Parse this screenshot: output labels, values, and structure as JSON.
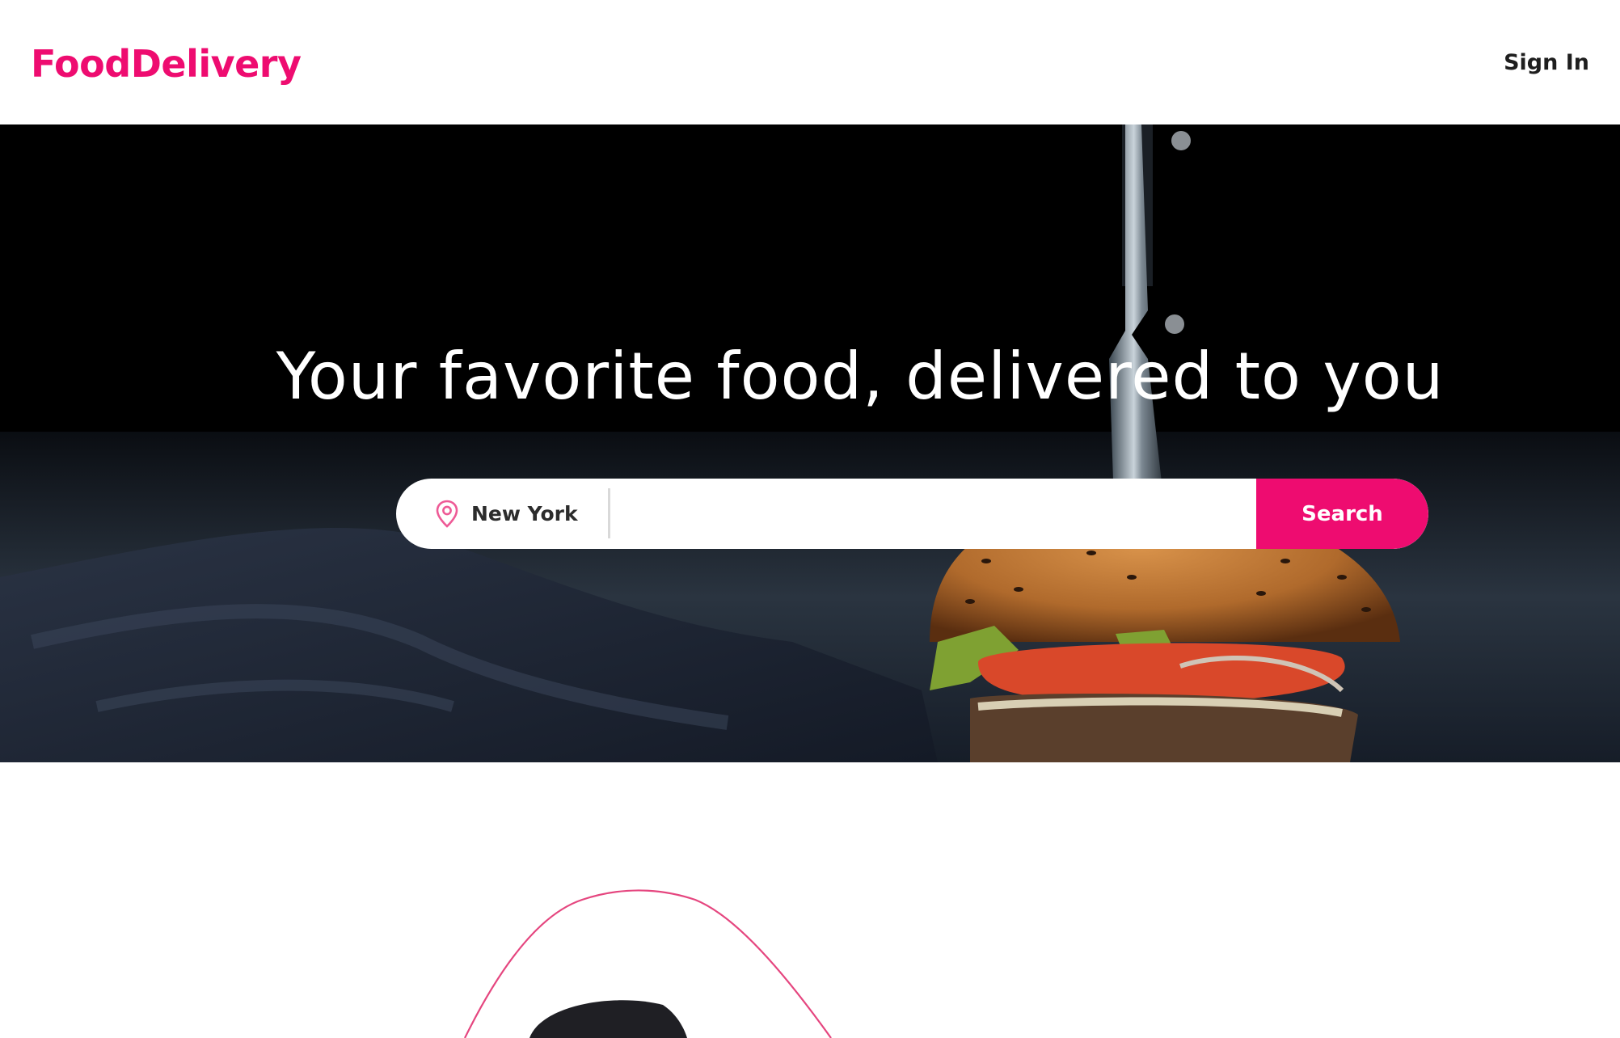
{
  "brand": {
    "name": "FoodDelivery",
    "color": "#ee0c70"
  },
  "header": {
    "sign_in_label": "Sign In"
  },
  "hero": {
    "title": "Your favorite food, delivered to you",
    "image": "burger-with-knife-photo"
  },
  "search": {
    "location_icon": "map-pin-icon",
    "location": "New York",
    "query_value": "",
    "button_label": "Search"
  },
  "colors": {
    "accent": "#ee0c70",
    "text_dark": "#1e1e1e",
    "hero_bg": "#000000"
  }
}
